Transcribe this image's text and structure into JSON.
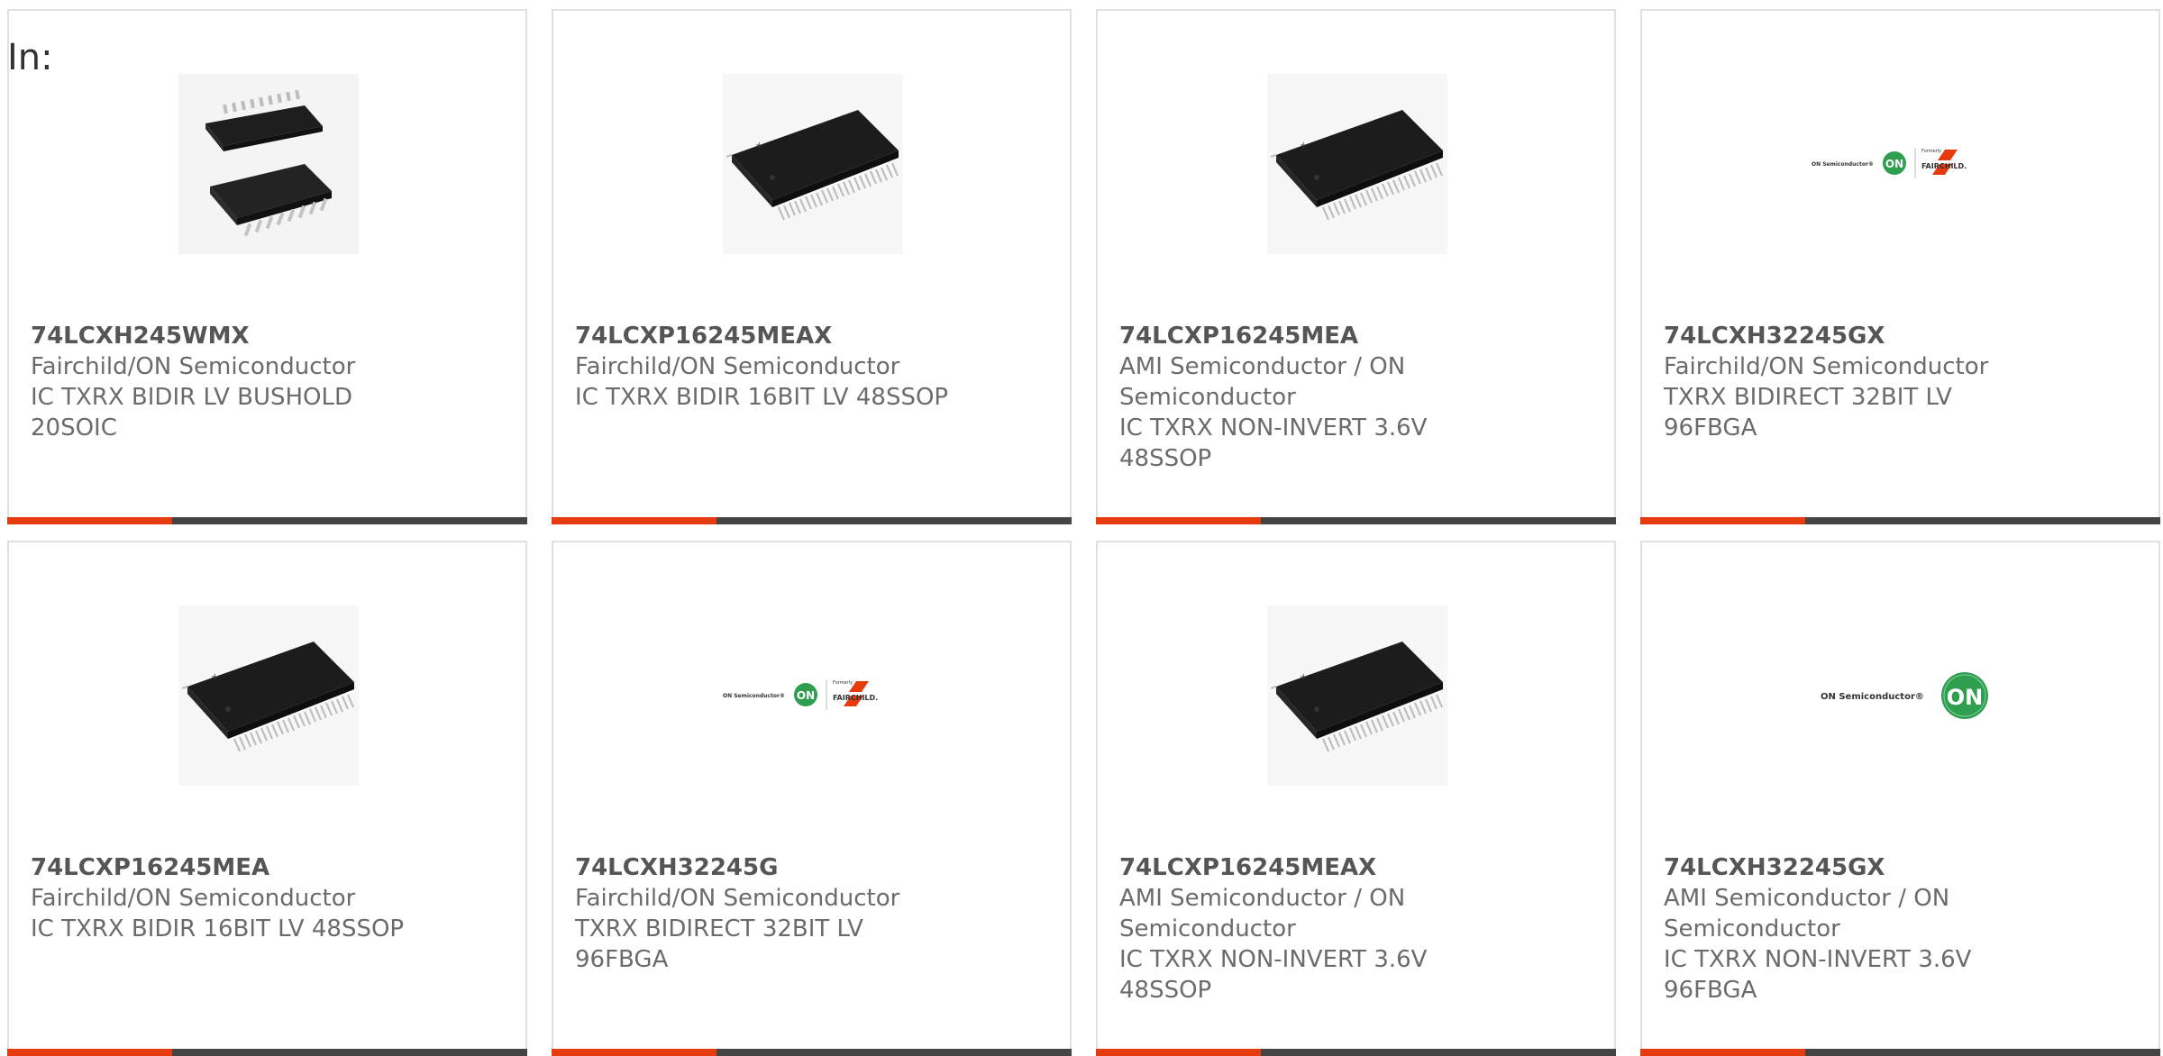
{
  "header": {
    "in_label": "In:"
  },
  "colors": {
    "accent": "#e63a0f",
    "bar": "#444444",
    "border": "#e0e0e0"
  },
  "products": [
    {
      "part": "74LCXH245WMX",
      "manufacturer": "Fairchild/ON Semiconductor",
      "description": "IC TXRX BIDIR LV BUSHOLD 20SOIC",
      "image": "soic-chip"
    },
    {
      "part": "74LCXP16245MEAX",
      "manufacturer": "Fairchild/ON Semiconductor",
      "description": "IC TXRX BIDIR 16BIT LV 48SSOP",
      "image": "ssop-chip"
    },
    {
      "part": "74LCXP16245MEA",
      "manufacturer": "AMI Semiconductor / ON Semiconductor",
      "description": "IC TXRX NON-INVERT 3.6V 48SSOP",
      "image": "ssop-chip"
    },
    {
      "part": "74LCXH32245GX",
      "manufacturer": "Fairchild/ON Semiconductor",
      "description": "TXRX BIDIRECT 32BIT LV 96FBGA",
      "image": "on-fairchild-logo"
    },
    {
      "part": "74LCXP16245MEA",
      "manufacturer": "Fairchild/ON Semiconductor",
      "description": "IC TXRX BIDIR 16BIT LV 48SSOP",
      "image": "ssop-chip"
    },
    {
      "part": "74LCXH32245G",
      "manufacturer": "Fairchild/ON Semiconductor",
      "description": "TXRX BIDIRECT 32BIT LV 96FBGA",
      "image": "on-fairchild-logo"
    },
    {
      "part": "74LCXP16245MEAX",
      "manufacturer": "AMI Semiconductor / ON Semiconductor",
      "description": "IC TXRX NON-INVERT 3.6V 48SSOP",
      "image": "ssop-chip"
    },
    {
      "part": "74LCXH32245GX",
      "manufacturer": "AMI Semiconductor / ON Semiconductor",
      "description": "IC TXRX NON-INVERT 3.6V 96FBGA",
      "image": "on-semiconductor-logo"
    }
  ],
  "logos": {
    "on_semi_small": "ON Semiconductor®",
    "on_semi": "ON Semiconductor®",
    "on_badge": "ON",
    "formerly": "Formerly",
    "fairchild": "FAIRCHILD."
  }
}
